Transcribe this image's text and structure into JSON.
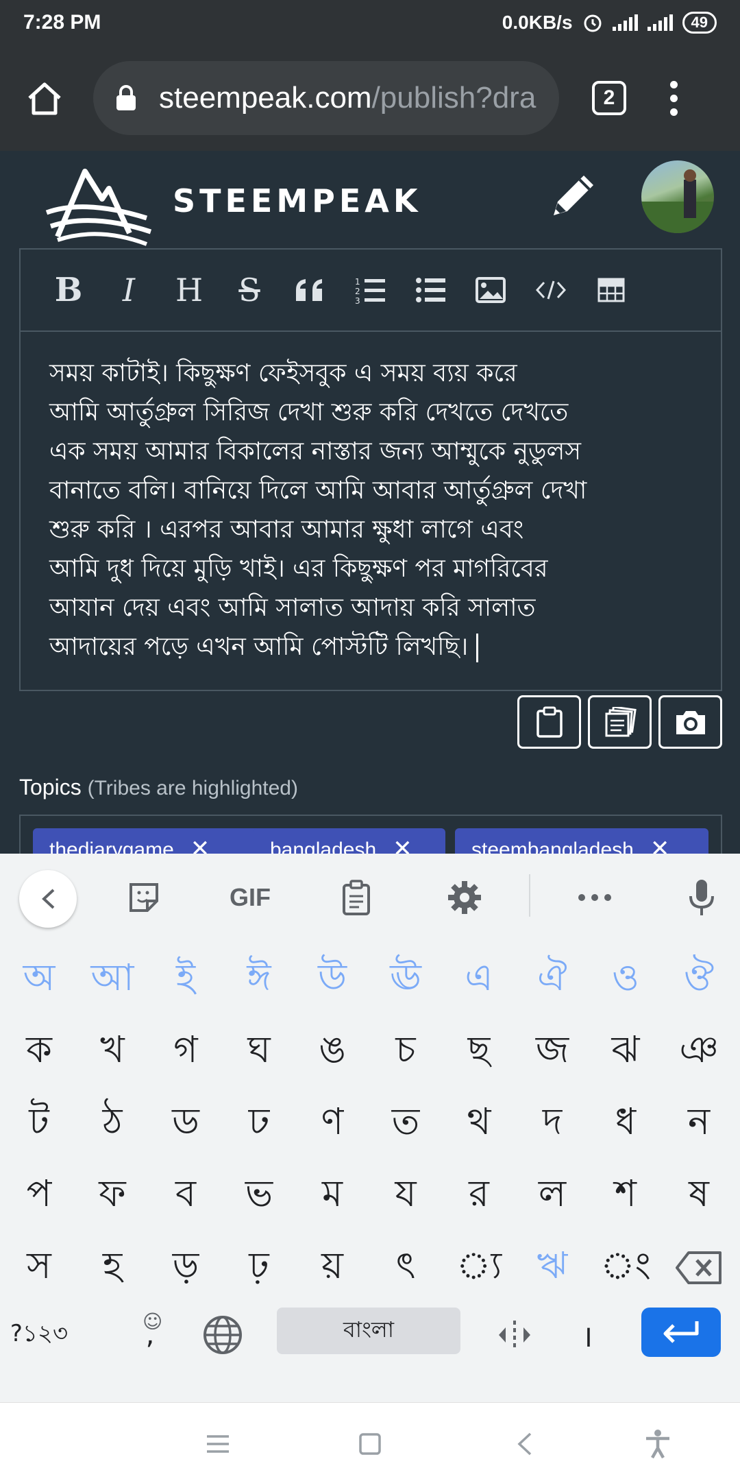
{
  "status": {
    "time": "7:28 PM",
    "net_speed": "0.0KB/s",
    "battery": "49"
  },
  "browser": {
    "url_host": "steempeak.com",
    "url_path": "/publish?dra",
    "tab_count": "2"
  },
  "site": {
    "brand": "STEEMPEAK"
  },
  "editor": {
    "toolbar": [
      "bold",
      "italic",
      "heading",
      "strikethrough",
      "quote",
      "ordered-list",
      "unordered-list",
      "image",
      "code",
      "table"
    ],
    "text": "সময় কাটাই। কিছুক্ষণ ফেইসবুক এ সময় ব্যয় করে\nআমি আর্তুগ্রুল সিরিজ দেখা শুরু করি দেখতে দেখতে\nএক সময় আমার বিকালের নাস্তার জন্য আম্মুকে নুডুলস\nবানাতে বলি। বানিয়ে দিলে আমি আবার আর্তুগ্রুল দেখা\nশুরু করি । এরপর আবার আমার ক্ষুধা লাগে এবং\nআমি দুধ দিয়ে মুড়ি খাই। এর কিছুক্ষণ পর মাগরিবের\nআযান দেয় এবং আমি সালাত আদায় করি সালাত\nআদায়ের পড়ে এখন আমি পোস্টটি লিখছি।"
  },
  "topics": {
    "label": "Topics",
    "hint": "(Tribes are highlighted)",
    "tags": [
      "thediarygame",
      "bangladesh",
      "steembangladesh"
    ]
  },
  "keyboard": {
    "suggest_gif": "GIF",
    "vowels": [
      "অ",
      "আ",
      "ই",
      "ঈ",
      "উ",
      "ঊ",
      "এ",
      "ঐ",
      "ও",
      "ঔ"
    ],
    "row1": [
      "ক",
      "খ",
      "গ",
      "ঘ",
      "ঙ",
      "চ",
      "ছ",
      "জ",
      "ঝ",
      "ঞ"
    ],
    "row2": [
      "ট",
      "ঠ",
      "ড",
      "ঢ",
      "ণ",
      "ত",
      "থ",
      "দ",
      "ধ",
      "ন"
    ],
    "row3": [
      "প",
      "ফ",
      "ব",
      "ভ",
      "ম",
      "য",
      "র",
      "ল",
      "শ",
      "ষ"
    ],
    "row4": [
      "স",
      "হ",
      "ড়",
      "ঢ়",
      "য়",
      "ৎ",
      "্য",
      "ঋ",
      "ং"
    ],
    "symbols_key": "?১২৩",
    "comma_key": ",",
    "space_label": "বাংলা",
    "period_key": "।"
  }
}
